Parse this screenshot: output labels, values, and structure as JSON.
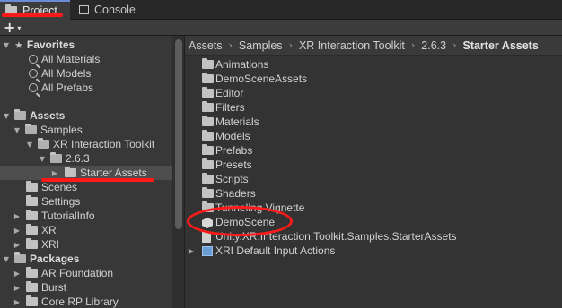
{
  "tabs": [
    {
      "label": "Project",
      "icon": "folder-icon",
      "active": true
    },
    {
      "label": "Console",
      "icon": "console-icon",
      "active": false
    }
  ],
  "toolbar": {
    "create_label": "+",
    "create_caret": "▾"
  },
  "tree": {
    "favorites": {
      "label": "Favorites",
      "items": [
        "All Materials",
        "All Models",
        "All Prefabs"
      ]
    },
    "assets": {
      "label": "Assets",
      "samples": "Samples",
      "xrit": "XR Interaction Toolkit",
      "version": "2.6.3",
      "starter": "Starter Assets",
      "others": [
        "Scenes",
        "Settings",
        "TutorialInfo",
        "XR",
        "XRI"
      ]
    },
    "packages": {
      "label": "Packages",
      "items": [
        "AR Foundation",
        "Burst",
        "Core RP Library"
      ]
    }
  },
  "breadcrumb": [
    "Assets",
    "Samples",
    "XR Interaction Toolkit",
    "2.6.3",
    "Starter Assets"
  ],
  "breadcrumb_sep": "›",
  "assets": [
    {
      "label": "Animations",
      "icon": "folder-icon"
    },
    {
      "label": "DemoSceneAssets",
      "icon": "folder-icon"
    },
    {
      "label": "Editor",
      "icon": "folder-icon"
    },
    {
      "label": "Filters",
      "icon": "folder-icon"
    },
    {
      "label": "Materials",
      "icon": "folder-icon"
    },
    {
      "label": "Models",
      "icon": "folder-icon"
    },
    {
      "label": "Prefabs",
      "icon": "folder-icon"
    },
    {
      "label": "Presets",
      "icon": "folder-icon"
    },
    {
      "label": "Scripts",
      "icon": "folder-icon"
    },
    {
      "label": "Shaders",
      "icon": "folder-icon"
    },
    {
      "label": "Tunneling Vignette",
      "icon": "folder-icon"
    },
    {
      "label": "DemoScene",
      "icon": "unity-scene-icon"
    },
    {
      "label": "Unity.XR.Interaction.Toolkit.Samples.StarterAssets",
      "icon": "assembly-definition-icon"
    },
    {
      "label": "XRI Default Input Actions",
      "icon": "input-actions-icon"
    }
  ],
  "colors": {
    "annotation": "#ff1a1a",
    "active_tab_accent": "#6a8bd6"
  }
}
